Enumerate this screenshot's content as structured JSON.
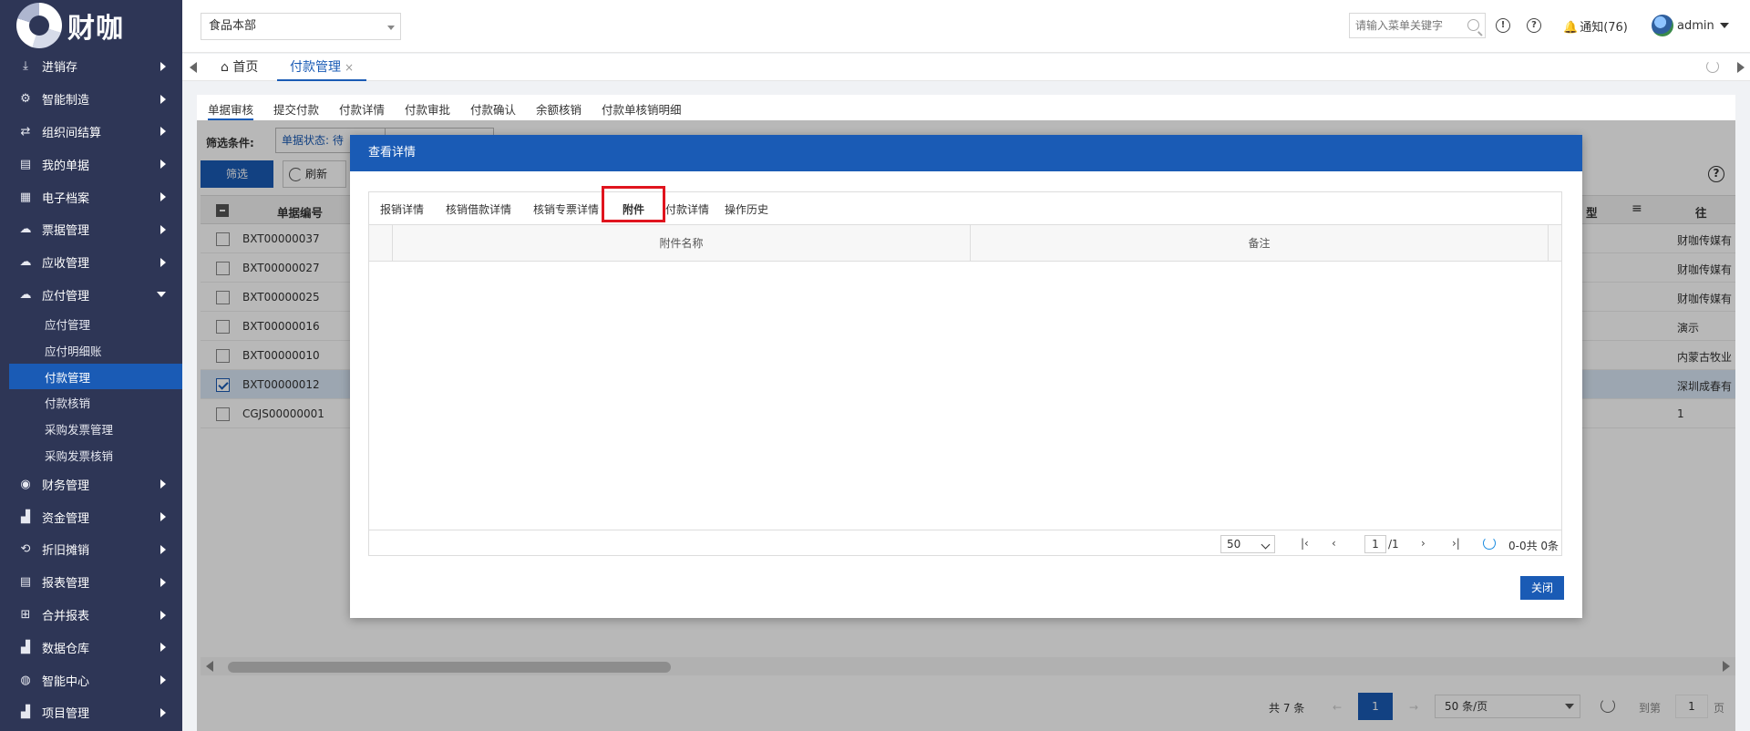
{
  "brand": {
    "name": "财咖"
  },
  "sidebar": {
    "items": [
      {
        "label": "进销存",
        "icon": "download-icon"
      },
      {
        "label": "智能制造",
        "icon": "gears-icon"
      },
      {
        "label": "组织间结算",
        "icon": "transfer-icon"
      },
      {
        "label": "我的单据",
        "icon": "document-icon"
      },
      {
        "label": "电子档案",
        "icon": "archive-icon"
      },
      {
        "label": "票据管理",
        "icon": "cloud-icon"
      },
      {
        "label": "应收管理",
        "icon": "cloud-icon"
      },
      {
        "label": "应付管理",
        "icon": "cloud-icon"
      }
    ],
    "sub_items": [
      "应付管理",
      "应付明细账",
      "付款管理",
      "付款核销",
      "采购发票管理",
      "采购发票核销"
    ],
    "active_sub": "付款管理",
    "items_after": [
      {
        "label": "财务管理",
        "icon": "coin-icon"
      },
      {
        "label": "资金管理",
        "icon": "bar-chart-icon"
      },
      {
        "label": "折旧摊销",
        "icon": "loop-icon"
      },
      {
        "label": "报表管理",
        "icon": "report-icon"
      },
      {
        "label": "合并报表",
        "icon": "merge-icon"
      },
      {
        "label": "数据仓库",
        "icon": "bar-chart-icon"
      },
      {
        "label": "智能中心",
        "icon": "globe-icon"
      },
      {
        "label": "项目管理",
        "icon": "bar-chart-icon"
      }
    ]
  },
  "header": {
    "org": "食品本部",
    "search_placeholder": "请输入菜单关键字",
    "notify": "通知(76)",
    "user": "admin"
  },
  "page_tabs": {
    "home": "首页",
    "current": "付款管理",
    "close_icon": "×"
  },
  "sub_tabs": [
    "单据审核",
    "提交付款",
    "付款详情",
    "付款审批",
    "付款确认",
    "余额核销",
    "付款单核销明细"
  ],
  "filter": {
    "label": "筛选条件:",
    "status": "单据状态: 待",
    "btn_filter": "筛选",
    "btn_refresh": "刷新"
  },
  "grid": {
    "col_code": "单据编号",
    "col_type_tail": "型",
    "col_menu": "≡",
    "col_last": "往",
    "rows": [
      {
        "code": "BXT00000037",
        "last": "财咖传媒有"
      },
      {
        "code": "BXT00000027",
        "last": "财咖传媒有"
      },
      {
        "code": "BXT00000025",
        "last": "财咖传媒有"
      },
      {
        "code": "BXT00000016",
        "last": "演示"
      },
      {
        "code": "BXT00000010",
        "last": "内蒙古牧业"
      },
      {
        "code": "BXT00000012",
        "last": "深圳成春有",
        "selected": true
      },
      {
        "code": "CGJS00000001",
        "last": "1"
      }
    ]
  },
  "pager": {
    "total": "共 7 条",
    "prev": "←",
    "page": "1",
    "next": "→",
    "size": "50 条/页",
    "goto": "到第",
    "goto_page": "1",
    "page_unit": "页"
  },
  "modal": {
    "title": "查看详情",
    "tabs": [
      "报销详情",
      "核销借款详情",
      "核销专票详情",
      "附件",
      "付款详情",
      "操作历史"
    ],
    "active_tab": "附件",
    "columns": [
      "附件名称",
      "备注"
    ],
    "pager": {
      "size": "50",
      "first": "|‹",
      "prev": "‹",
      "page": "1",
      "page_total": "/1",
      "next": "›",
      "last": "›|",
      "range": "0-0共 0条"
    },
    "close_btn": "关闭"
  },
  "colors": {
    "sidebar_bg": "#2e3656",
    "primary": "#1a5bb5",
    "highlight": "#e0141e"
  }
}
